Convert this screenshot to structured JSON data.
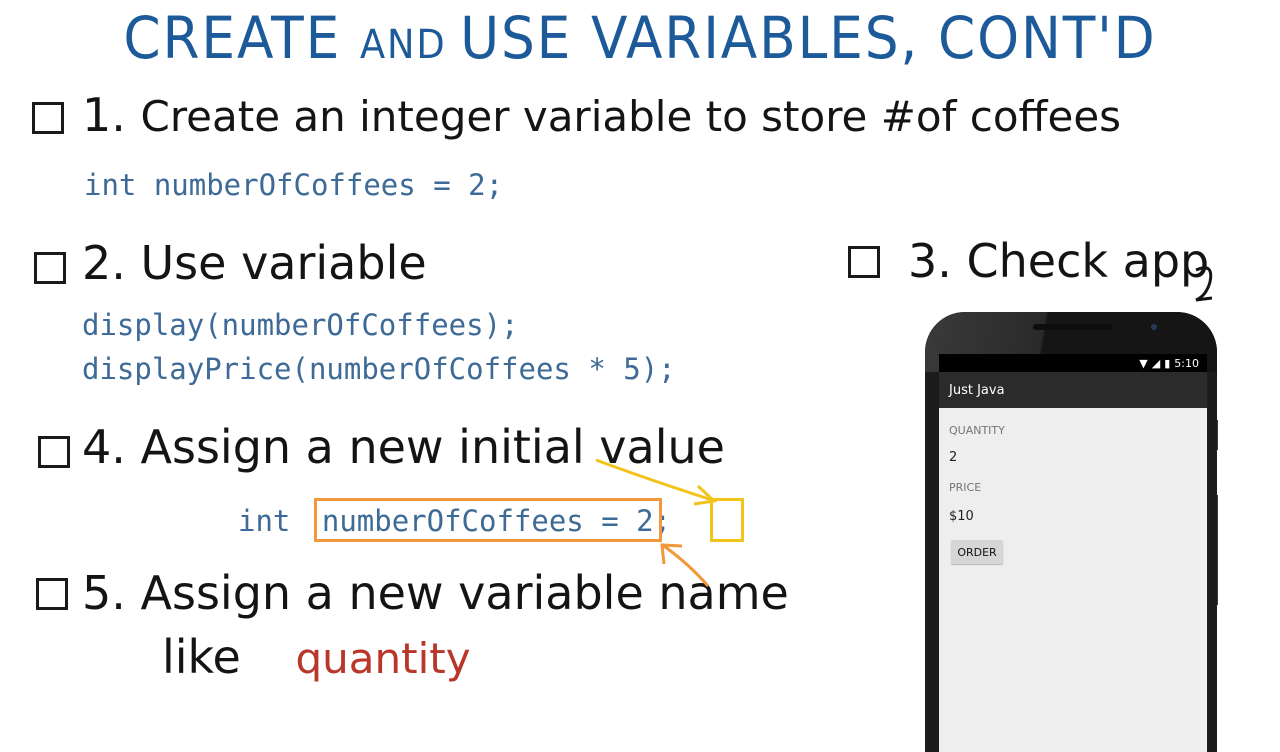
{
  "title": {
    "main": "CREATE ",
    "and": "AND ",
    "rest": "USE VARIABLES, CONT'D"
  },
  "steps": {
    "s1": {
      "number": "1.",
      "text": "Create an integer variable to store #of coffees"
    },
    "s2": {
      "number": "2.",
      "text": "Use variable"
    },
    "s3": {
      "number": "3.",
      "text": "Check app"
    },
    "s4": {
      "number": "4.",
      "text": "Assign a new initial value"
    },
    "s5": {
      "number": "5.",
      "text": "Assign a new variable name",
      "line2": "like",
      "suggestion": "quantity"
    }
  },
  "code": {
    "line1": "int numberOfCoffees = 2;",
    "line2": "display(numberOfCoffees);",
    "line3": "displayPrice(numberOfCoffees * 5);",
    "line4": {
      "type": "int",
      "name": "numberOfCoffees",
      "equals": "=",
      "value": "2",
      "semicolon": ";"
    }
  },
  "annotations": {
    "highlight_name_color": "#f0983a",
    "highlight_value_color": "#f2c31b"
  },
  "phone": {
    "status_time": "5:10",
    "app_title": "Just Java",
    "quantity_label": "QUANTITY",
    "quantity_value": "2",
    "price_label": "PRICE",
    "price_value": "$10",
    "order_button": "ORDER"
  }
}
